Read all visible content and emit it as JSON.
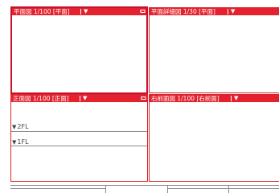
{
  "panes": [
    {
      "title": "平面図 1/100 [平面]",
      "dropdown_icon": "caret-down-icon",
      "pin_icon": "pin-icon"
    },
    {
      "title": "平面詳細図 1/30 [平面]",
      "dropdown_icon": "caret-down-icon"
    },
    {
      "title": "正面図 1/100 [正面]",
      "dropdown_icon": "caret-down-icon",
      "pin_icon": "pin-icon",
      "levels": [
        {
          "marker": "▼",
          "label": "2FL"
        },
        {
          "marker": "▼",
          "label": "1FL"
        }
      ]
    },
    {
      "title": "右前面図 1/100 [右前面]",
      "dropdown_icon": "caret-down-icon"
    }
  ],
  "colors": {
    "header": "#e4222f",
    "border": "#d9242a",
    "active_border": "#c8102e"
  }
}
